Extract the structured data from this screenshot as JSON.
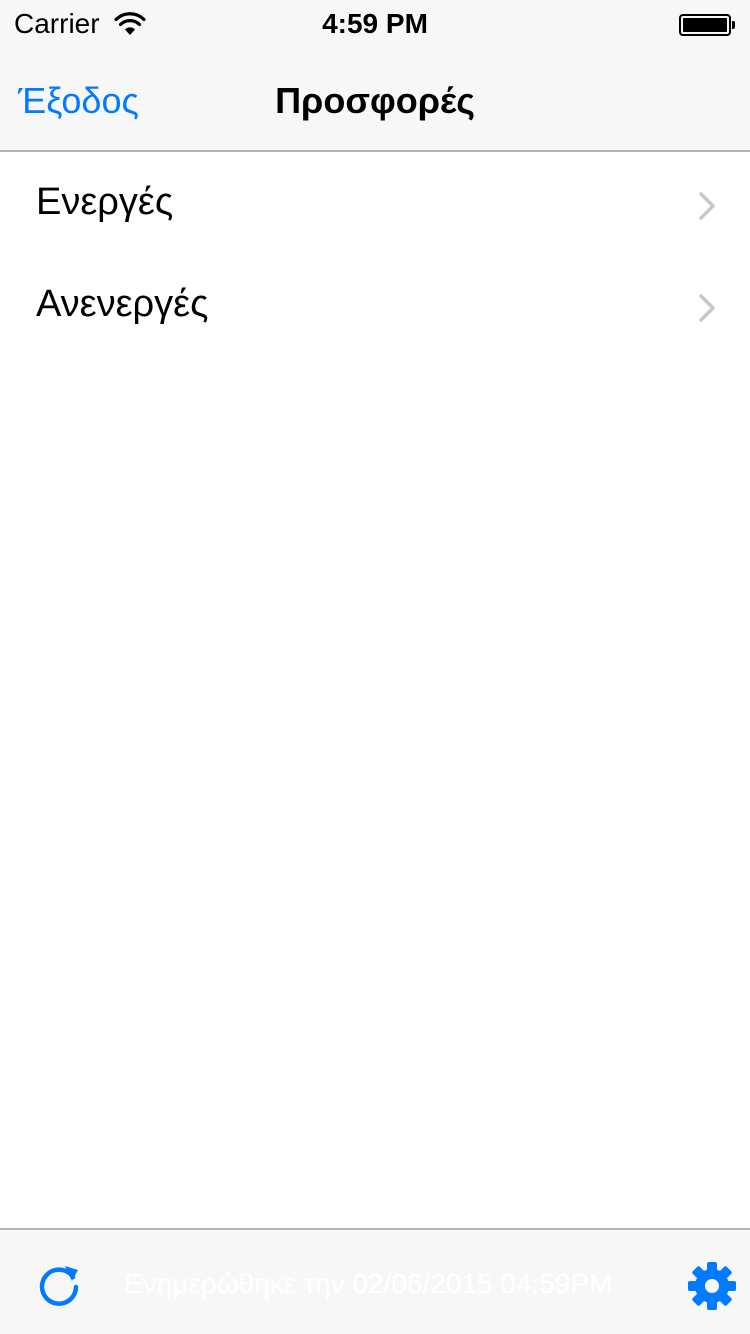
{
  "status_bar": {
    "carrier": "Carrier",
    "time": "4:59 PM",
    "wifi_icon": "wifi-icon",
    "battery_icon": "battery-icon"
  },
  "nav_bar": {
    "back_label": "Έξοδος",
    "title": "Προσφορές"
  },
  "list": {
    "items": [
      {
        "label": "Ενεργές",
        "icon": "chevron-right-icon"
      },
      {
        "label": "Ανενεργές",
        "icon": "chevron-right-icon"
      }
    ]
  },
  "toolbar": {
    "refresh_icon": "refresh-icon",
    "updated_text": "Ενημερώθηκε την 02/06/2015 04:59PM",
    "settings_icon": "gear-icon"
  },
  "colors": {
    "accent": "#007aff",
    "bar_background": "#f7f7f7",
    "separator": "#b2b2b2",
    "chevron": "#c7c7cc"
  }
}
